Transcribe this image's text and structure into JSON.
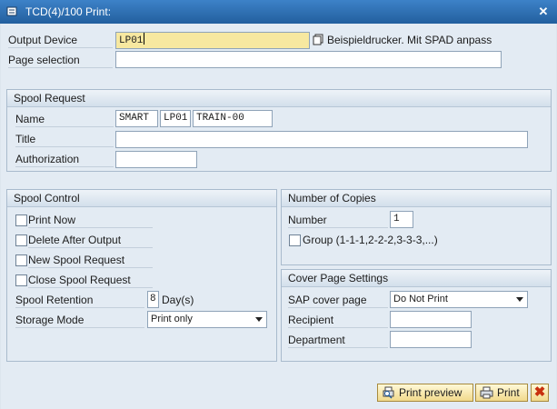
{
  "window": {
    "title": "TCD(4)/100 Print:",
    "close_glyph": "✕"
  },
  "top": {
    "output_device_label": "Output Device",
    "output_device_value": "LP01",
    "output_device_desc": "Beispieldrucker. Mit SPAD anpass",
    "page_selection_label": "Page selection",
    "page_selection_value": ""
  },
  "spool_request": {
    "heading": "Spool Request",
    "name_label": "Name",
    "name_parts": [
      "SMART",
      "LP01",
      "TRAIN-00"
    ],
    "title_label": "Title",
    "title_value": "",
    "authorization_label": "Authorization",
    "authorization_value": ""
  },
  "spool_control": {
    "heading": "Spool Control",
    "print_now_label": "Print Now",
    "delete_after_output_label": "Delete After Output",
    "new_spool_request_label": "New Spool Request",
    "close_spool_request_label": "Close Spool Request",
    "retention_label": "Spool Retention",
    "retention_value": "8",
    "retention_unit": "Day(s)",
    "storage_mode_label": "Storage Mode",
    "storage_mode_value": "Print only"
  },
  "copies": {
    "heading": "Number of Copies",
    "number_label": "Number",
    "number_value": "1",
    "group_label": "Group (1-1-1,2-2-2,3-3-3,...)"
  },
  "cover_page": {
    "heading": "Cover Page Settings",
    "sap_cover_label": "SAP cover page",
    "sap_cover_value": "Do Not Print",
    "recipient_label": "Recipient",
    "recipient_value": "",
    "department_label": "Department",
    "department_value": ""
  },
  "footer": {
    "print_preview_label": "Print preview",
    "print_label": "Print",
    "cancel_glyph": "✖"
  }
}
